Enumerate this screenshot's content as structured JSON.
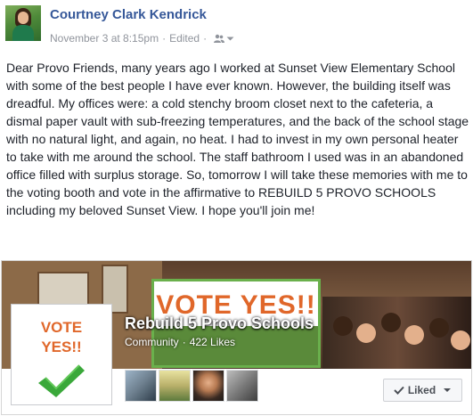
{
  "post": {
    "author": "Courtney Clark Kendrick",
    "date": "November 3 at 8:15pm",
    "separator": "·",
    "edited": "Edited",
    "body": "Dear Provo Friends, many years ago I worked at Sunset View Elementary School with some of the best people I have ever known. However, the building itself was dreadful. My offices were: a cold stenchy broom closet next to the cafeteria, a dismal paper vault with sub-freezing temperatures, and the back of the school stage with no natural light, and again, no heat. I had to invest in my own personal heater to take with me around the school. The staff bathroom I used was in an abandoned office filled with surplus storage. So, tomorrow I will take these memories with me to the voting booth and vote in the affirmative to REBUILD 5 PROVO SCHOOLS including my beloved Sunset View. I hope you'll join me!"
  },
  "page_card": {
    "cover_sign_text": "VOTE YES!!",
    "name": "Rebuild 5 Provo Schools",
    "category": "Community",
    "dot": "·",
    "likes": "422 Likes",
    "profile_line1": "VOTE",
    "profile_line2": "YES!!",
    "liked_label": "Liked",
    "friend_count": 4
  },
  "icons": {
    "audience": "friends-icon",
    "dropdown": "chevron-down-icon",
    "check": "checkmark-icon",
    "liked_check": "check-icon"
  },
  "colors": {
    "link_blue": "#365899",
    "meta_gray": "#90949c",
    "vote_orange": "#e0672a",
    "check_green": "#3aa83a"
  }
}
